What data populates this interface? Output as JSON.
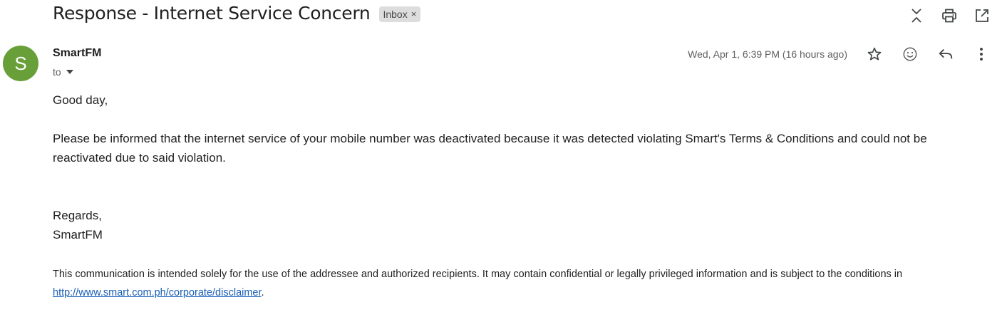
{
  "email": {
    "subject": "Response - Internet Service Concern",
    "label": "Inbox",
    "label_close": "×",
    "sender": {
      "name": "SmartFM",
      "avatar_letter": "S",
      "avatar_color": "#689f38",
      "to_label": "to"
    },
    "timestamp": "Wed, Apr 1, 6:39 PM (16 hours ago)",
    "body": {
      "greeting": "Good day,",
      "paragraph": "Please be informed that the internet service of your mobile number was deactivated because it was detected violating Smart's Terms & Conditions and could not be reactivated due to said violation.",
      "regards": "Regards,",
      "signature": "SmartFM"
    },
    "disclaimer": {
      "text": "This communication is intended solely for the use of the addressee and authorized recipients. It may contain confidential or legally privileged information and is subject to the conditions in ",
      "link": "http://www.smart.com.ph/corporate/disclaimer",
      "suffix": "."
    }
  },
  "icons": {
    "top_actions": [
      "collapse-all-icon",
      "print-icon",
      "open-in-new-window-icon"
    ],
    "message_actions": [
      "star-icon",
      "emoji-reaction-icon",
      "reply-icon",
      "more-options-icon"
    ],
    "recipient_toggle": "chevron-down-icon"
  },
  "colors": {
    "link": "#1a5fb4",
    "chip_bg": "#dddddd",
    "muted_text": "#5e5e5e"
  }
}
